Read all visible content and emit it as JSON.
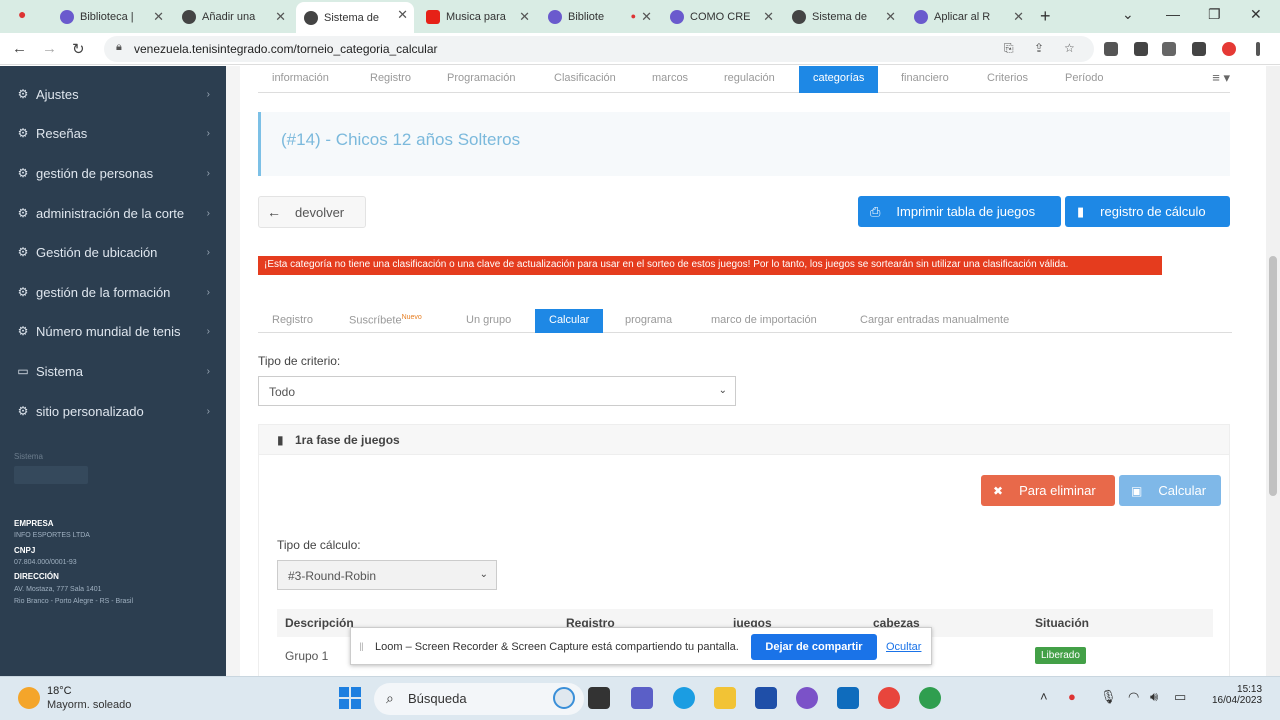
{
  "browser": {
    "tabs": [
      {
        "title": "Biblioteca |",
        "color": "#6a5acd",
        "active": false
      },
      {
        "title": "Añadir una",
        "color": "#444444",
        "active": false
      },
      {
        "title": "Sistema de",
        "color": "#444444",
        "active": true
      },
      {
        "title": "Musica para",
        "color": "#e62117",
        "active": false
      },
      {
        "title": "Bibliote",
        "color": "#6a5acd",
        "active": false
      },
      {
        "title": "COMO CRE",
        "color": "#6a5acd",
        "active": false
      },
      {
        "title": "Sistema de",
        "color": "#444444",
        "active": false
      },
      {
        "title": "Aplicar al R",
        "color": "#6a5acd",
        "active": false
      }
    ],
    "url": "venezuela.tenisintegrado.com/torneio_categoria_calcular"
  },
  "sidebar": {
    "items": [
      {
        "label": "Ajustes",
        "icon": "gear-icon"
      },
      {
        "label": "Reseñas",
        "icon": "gear-icon"
      },
      {
        "label": "gestión de personas",
        "icon": "gear-icon"
      },
      {
        "label": "administración de la corte",
        "icon": "gear-icon"
      },
      {
        "label": "Gestión de ubicación",
        "icon": "gear-icon"
      },
      {
        "label": "gestión de la formación",
        "icon": "gear-icon"
      },
      {
        "label": "Número mundial de tenis",
        "icon": "gear-icon"
      },
      {
        "label": "Sistema",
        "icon": "laptop-icon"
      },
      {
        "label": "sitio personalizado",
        "icon": "gear-icon"
      }
    ],
    "faint_label": "Sistema",
    "company_h": "EMPRESA",
    "company": "INFO ESPORTES LTDA",
    "cnpj_h": "CNPJ",
    "cnpj": "07.804.000/0001-93",
    "address_h": "DIRECCIÓN",
    "address1": "AV. Mostaza, 777 Sala 1401",
    "address2": "Rio Branco - Porto Alegre - RS - Brasil"
  },
  "topnav": [
    "información",
    "Registro",
    "Programación",
    "Clasificación",
    "marcos",
    "regulación",
    "categorías",
    "financiero",
    "Criterios",
    "Período"
  ],
  "topnav_active": "categorías",
  "page": {
    "title": "(#14) - Chicos 12 años Solteros",
    "back_label": "devolver",
    "print_label": "Imprimir tabla de juegos",
    "calc_log_label": "registro de cálculo",
    "alert": "¡Esta categoría no tiene una clasificación o una clave de actualización para usar en el sorteo de estos juegos! Por lo tanto, los juegos se sortearán sin utilizar una clasificación válida.",
    "subtabs": [
      "Registro",
      "Suscríbete",
      "Un grupo",
      "Calcular",
      "programa",
      "marco de importación",
      "Cargar entradas manualmente"
    ],
    "subtab_badge": "Nuevo",
    "criteria_label": "Tipo de criterio:",
    "criteria_value": "Todo",
    "panel_title": "1ra fase de juegos",
    "delete_label": "Para eliminar",
    "calculate_label": "Calcular",
    "calc_type_label": "Tipo de cálculo:",
    "calc_type_value": "#3-Round-Robin",
    "table_headers": [
      "Descripción",
      "Registro",
      "juegos",
      "cabezas",
      "Situación"
    ],
    "rows": [
      {
        "description": "Grupo 1",
        "status": "Liberado"
      }
    ]
  },
  "loom": {
    "message": "Loom – Screen Recorder & Screen Capture está compartiendo tu pantalla.",
    "stop_label": "Dejar de compartir",
    "hide_label": "Ocultar"
  },
  "taskbar": {
    "temp": "18°C",
    "weather": "Mayorm. soleado",
    "search": "Búsqueda",
    "time": "15:13",
    "date": "16/04/2023"
  }
}
